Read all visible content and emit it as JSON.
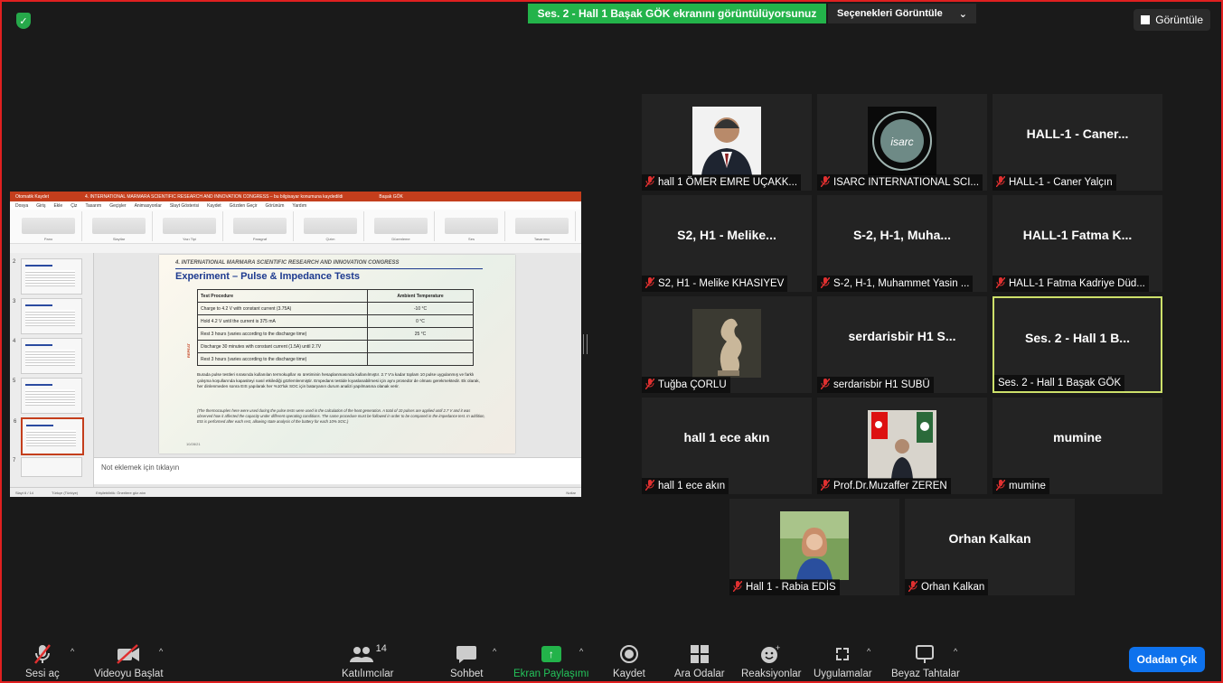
{
  "banner": {
    "share_text": "Ses. 2 - Hall 1 Başak GÖK ekranını görüntülüyorsunuz",
    "view_options": "Seçenekleri Görüntüle",
    "view_button": "Görüntüle"
  },
  "shared_screen": {
    "window_title": "4. INTERNATIONAL MARMARA SCIENTIFIC RESEARCH AND INNOVATION CONGRESS – bu bilgisayar konumuna kaydedildi",
    "autosave": "Otomatik Kaydet",
    "user": "Başak GÖK",
    "menu": [
      "Dosya",
      "Giriş",
      "Ekle",
      "Çiz",
      "Tasarım",
      "Geçişler",
      "Animasyonlar",
      "Slayt Gösterisi",
      "Kaydet",
      "Gözden Geçir",
      "Görünüm",
      "Yardım"
    ],
    "ribbon_groups": [
      "Pano",
      "Slaytlar",
      "Yazı Tipi",
      "Paragraf",
      "Çizim",
      "Düzenleme",
      "Ses",
      "Tasarımcı"
    ],
    "thumb_numbers": [
      "2",
      "3",
      "4",
      "5",
      "6",
      "7"
    ],
    "slide": {
      "congress": "4. INTERNATIONAL MARMARA SCIENTIFIC RESEARCH AND INNOVATION CONGRESS",
      "title": "Experiment – Pulse & Impedance Tests",
      "table_headers": [
        "Test Procedure",
        "Ambient Temperature"
      ],
      "rows": [
        [
          "Charge to 4.2 V with constant current (3.75A)",
          "-10 °C"
        ],
        [
          "Hold 4.2 V until the current is 375 mA",
          "0 °C"
        ],
        [
          "Rest 3 hours (varies according to the discharge time)",
          "25 °C"
        ],
        [
          "Discharge 30 minutes with constant current (1.5A) until 2.7V",
          ""
        ],
        [
          "Rest 3 hours (varies according to the discharge time)",
          ""
        ]
      ],
      "repeat": "REPEAT",
      "paragraph": "Burada pulse testleri sırasında kullanılan termokupllar ısı üretiminin hesaplanmasında kullanılmıştır. 2.7 V'a kadar toplam 10 pulse uygulanmış ve farklı çalışma koşullarında kapasiteyi nasıl etkilediği gözlemlenmiştir. Empedans testide kıyaslanabilmesi için aynı prosedür de olması gerekmektedir. Ek olarak, her dinlenmeden sonra EIS yapılarak her %10'luk SOC için bataryanın durum analizi yapılmasına olanak verir.",
      "paragraph_en": "(The thermocouples here were used during the pulse tests were used in the calculation of the heat generation. A total of 10 pulses are applied until 2.7 V and it was observed how it affected the capacity under different operating conditions. The same procedure must be followed in order to be compared in the impedance test. In addition, EIS is performed after each rest, allowing state analysis of the battery for each 10% SOC.)",
      "footer": "10/28/21"
    },
    "notes_placeholder": "Not eklemek için tıklayın",
    "status_left": "Slayt 6 / 14",
    "status_lang": "Türkçe (Türkiye)",
    "status_access": "Erişilebilirlik: Önerilere göz atın",
    "status_notes": "Notlar"
  },
  "participants": [
    {
      "display": "",
      "name": "hall 1 ÖMER EMRE UÇAKK...",
      "has_photo": true,
      "photo": "man-portrait"
    },
    {
      "display": "",
      "name": "ISARC INTERNATIONAL SCI...",
      "has_photo": true,
      "photo": "isarc-logo"
    },
    {
      "display": "HALL-1 - Caner...",
      "name": "HALL-1 - Caner Yalçın",
      "has_photo": false
    },
    {
      "display": "S2, H1 - Melike...",
      "name": "S2, H1 - Melike KHASIYEV",
      "has_photo": false
    },
    {
      "display": "S-2, H-1, Muha...",
      "name": "S-2, H-1, Muhammet Yasin ...",
      "has_photo": false
    },
    {
      "display": "HALL-1 Fatma K...",
      "name": "HALL-1 Fatma Kadriye Düd...",
      "has_photo": false
    },
    {
      "display": "",
      "name": "Tuğba ÇORLU",
      "has_photo": true,
      "photo": "sculpture"
    },
    {
      "display": "serdarisbir H1 S...",
      "name": "serdarisbir H1 SUBÜ",
      "has_photo": false
    },
    {
      "display": "Ses. 2 - Hall 1 B...",
      "name": "Ses. 2 - Hall 1 Başak GÖK",
      "has_photo": false,
      "active": true
    },
    {
      "display": "hall 1 ece akın",
      "name": "hall 1 ece akın",
      "has_photo": false
    },
    {
      "display": "",
      "name": "Prof.Dr.Muzaffer ZEREN",
      "has_photo": true,
      "photo": "flags-portrait"
    },
    {
      "display": "mumine",
      "name": "mumine",
      "has_photo": false
    },
    {
      "display": "",
      "name": "Hall 1 - Rabia EDİS",
      "has_photo": true,
      "photo": "woman-portrait"
    },
    {
      "display": "Orhan Kalkan",
      "name": "Orhan Kalkan",
      "has_photo": false
    }
  ],
  "toolbar": {
    "audio": "Sesi aç",
    "video": "Videoyu Başlat",
    "participants": "Katılımcılar",
    "participants_count": "14",
    "chat": "Sohbet",
    "share": "Ekran Paylaşımı",
    "record": "Kaydet",
    "breakout": "Ara Odalar",
    "reactions": "Reaksiyonlar",
    "apps": "Uygulamalar",
    "whiteboard": "Beyaz Tahtalar",
    "leave": "Odadan Çık"
  },
  "colors": {
    "share_green": "#23b34a",
    "leave_blue": "#0e72ed",
    "active_border": "#cde06a",
    "mute_red": "#e03030"
  }
}
